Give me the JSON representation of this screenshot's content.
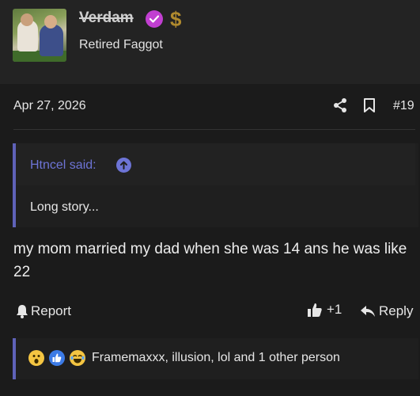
{
  "header": {
    "username": "Verdam",
    "badge_glyph": "$",
    "user_title": "Retired Faggot"
  },
  "post": {
    "date": "Apr 27, 2026",
    "number": "#19",
    "quote": {
      "author": "Htncel said:",
      "text": "Long story..."
    },
    "message": "my mom married my dad when she was 14 ans he was like 22",
    "actions": {
      "report": "Report",
      "like_count": "+1",
      "reply": "Reply"
    },
    "reactions": {
      "summary": "Framemaxxx, illusion, lol and 1 other person",
      "icons": [
        "wow-reaction-icon",
        "like-reaction-icon",
        "lol-reaction-icon"
      ]
    }
  },
  "colors": {
    "background": "#1b1b1b",
    "header_background": "#232323",
    "accent": "#5f62b8",
    "quote_author": "#6d74d6",
    "verified_badge": "#c13fd1",
    "dollar_badge": "#b08a2e"
  }
}
